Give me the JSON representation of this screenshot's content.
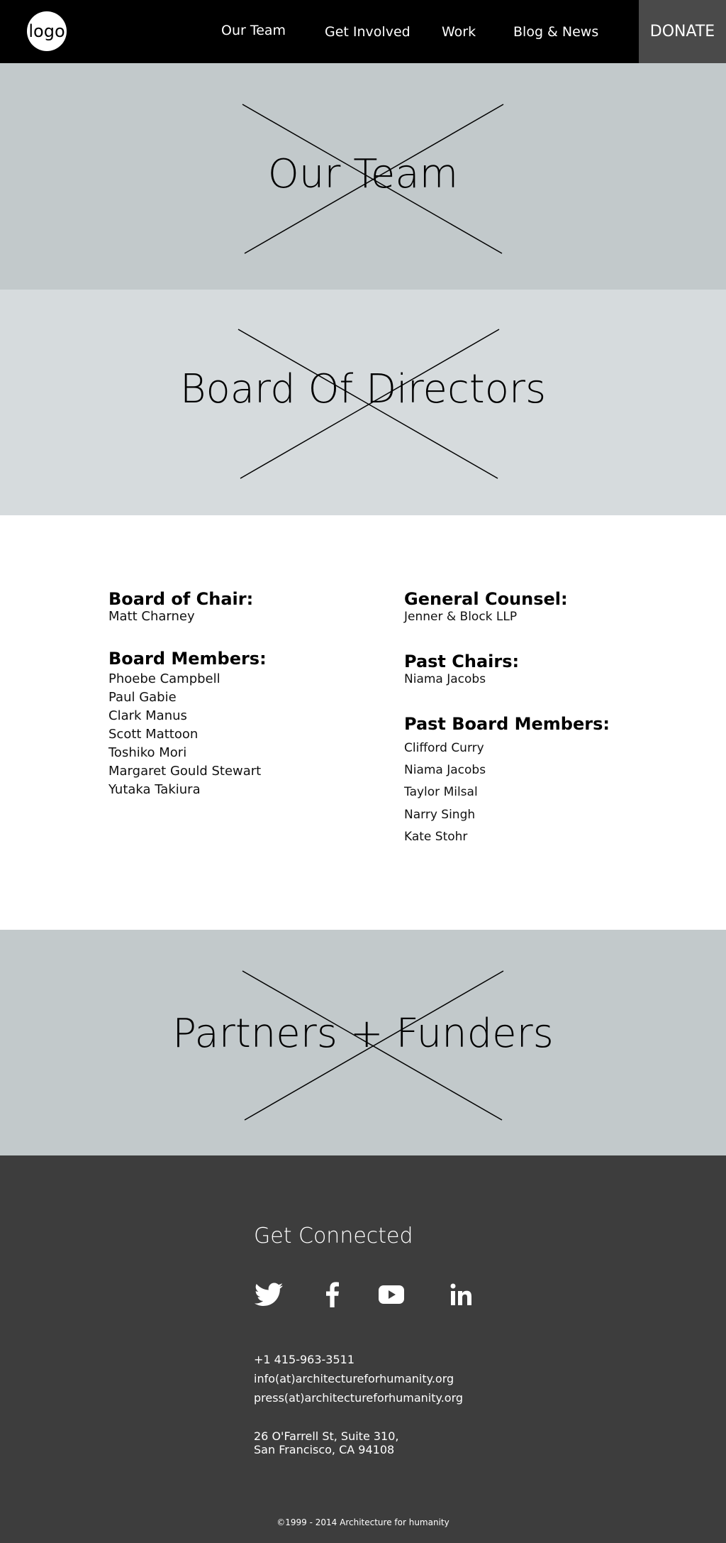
{
  "nav": {
    "logo": "logo",
    "links": [
      "Our Team",
      "Get Involved",
      "Work",
      "Blog & News"
    ],
    "donate": "DONATE"
  },
  "banners": {
    "our_team": "Our Team",
    "board": "Board Of Directors",
    "partners": "Partners + Funders"
  },
  "board": {
    "chair_heading": "Board of Chair:",
    "chair": "Matt Charney",
    "members_heading": "Board Members:",
    "members": [
      "Phoebe Campbell",
      "Paul Gabie",
      "Clark Manus",
      "Scott Mattoon",
      "Toshiko Mori",
      "Margaret Gould Stewart",
      "Yutaka Takiura"
    ],
    "counsel_heading": "General Counsel:",
    "counsel": "Jenner & Block LLP",
    "past_chairs_heading": "Past Chairs:",
    "past_chairs": [
      "Niama Jacobs"
    ],
    "past_members_heading": "Past Board Members:",
    "past_members": [
      "Clifford Curry",
      "Niama Jacobs",
      "Taylor Milsal",
      "Narry Singh",
      "Kate Stohr"
    ]
  },
  "footer": {
    "title": "Get Connected",
    "social": [
      "twitter-icon",
      "facebook-icon",
      "youtube-icon",
      "linkedin-icon"
    ],
    "phone": "+1 415-963-3511",
    "emails": [
      "info(at)architectureforhumanity.org",
      "press(at)architectureforhumanity.org"
    ],
    "address": [
      "26 O'Farrell St, Suite 310,",
      "San Francisco, CA 94108"
    ],
    "copyright": "©1999 - 2014 Architecture for humanity"
  }
}
